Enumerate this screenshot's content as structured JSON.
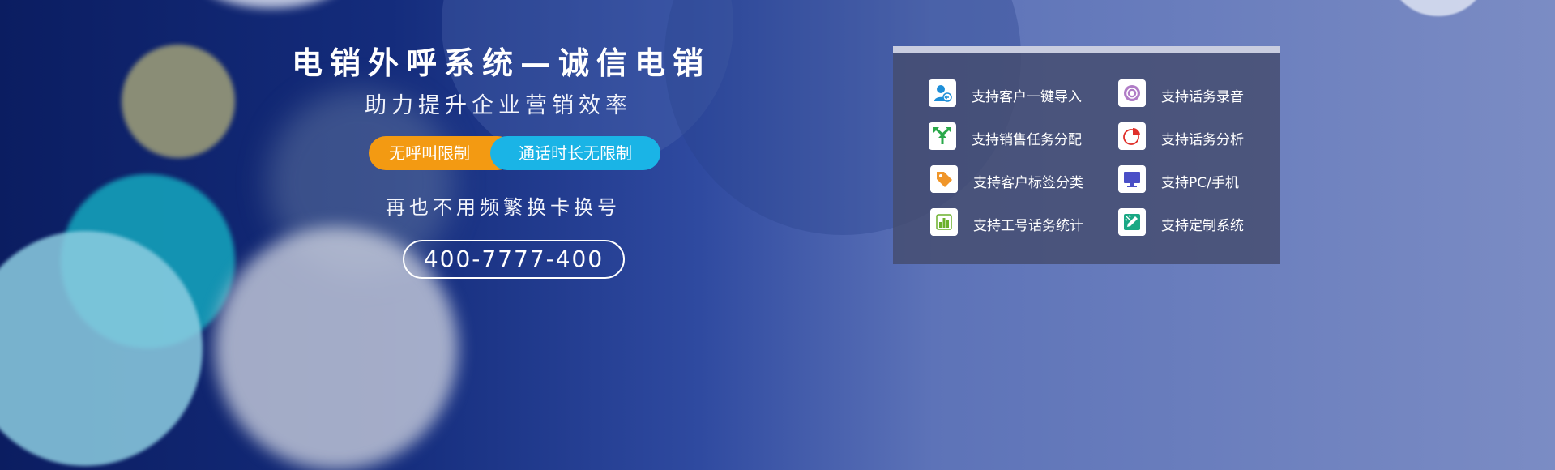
{
  "banner": {
    "title": "电销外呼系统—诚信电销",
    "subtitle": "助力提升企业营销效率",
    "badge_left": "无呼叫限制",
    "badge_right": "通话时长无限制",
    "tagline": "再也不用频繁换卡换号",
    "phone": "400-7777-400"
  },
  "features": [
    {
      "label": "支持客户一键导入",
      "icon": "user-import-icon",
      "color": "#1e8fd8"
    },
    {
      "label": "支持话务录音",
      "icon": "record-icon",
      "color": "#b07cc6"
    },
    {
      "label": "支持销售任务分配",
      "icon": "task-split-icon",
      "color": "#2aa84a"
    },
    {
      "label": "支持话务分析",
      "icon": "pie-chart-icon",
      "color": "#e0302a"
    },
    {
      "label": "支持客户标签分类",
      "icon": "tag-icon",
      "color": "#f0962a"
    },
    {
      "label": "支持PC/手机",
      "icon": "monitor-icon",
      "color": "#4a4fc7"
    },
    {
      "label": "支持工号话务统计",
      "icon": "bar-chart-icon",
      "color": "#6cb02c"
    },
    {
      "label": "支持定制系统",
      "icon": "pencil-ruler-icon",
      "color": "#1aa884"
    }
  ]
}
